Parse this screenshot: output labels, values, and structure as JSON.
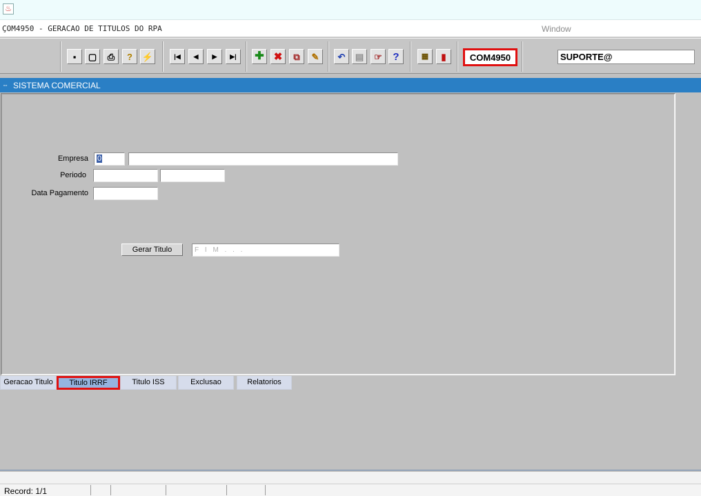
{
  "window": {
    "title": "ÇOM4950 - GERACAO DE TITULOS DO RPA",
    "menu_window": "Window"
  },
  "toolbar": {
    "icons": [
      "save-icon",
      "clear-icon",
      "print-icon",
      "query-enter-icon",
      "query-execute-icon",
      "first-record-icon",
      "previous-record-icon",
      "next-record-icon",
      "last-record-icon",
      "insert-record-icon",
      "delete-record-icon",
      "duplicate-record-icon",
      "edit-icon",
      "undo-icon",
      "list-icon",
      "lov-icon",
      "help-icon",
      "menu-icon",
      "exit-icon"
    ],
    "form_code": "COM4950",
    "user": "SUPORTE@"
  },
  "header": {
    "title": "SISTEMA COMERCIAL"
  },
  "form": {
    "empresa_label": "Empresa",
    "empresa_code": "0",
    "empresa_name": "",
    "periodo_label": "Periodo",
    "periodo_start": "",
    "periodo_end": "",
    "data_pagamento_label": "Data Pagamento",
    "data_pagamento": "",
    "gerar_button": "Gerar Titulo",
    "status_value": "F I M . . ."
  },
  "tabs": [
    {
      "label": "Geracao Titulo"
    },
    {
      "label": "Titulo IRRF",
      "highlighted": true
    },
    {
      "label": "Titulo ISS"
    },
    {
      "label": "Exclusao"
    },
    {
      "label": "Relatorios"
    }
  ],
  "statusbar": {
    "record": "Record: 1/1"
  },
  "colors": {
    "header_blue": "#2a7fc5",
    "highlight_red": "#e01010",
    "selected_tab": "#95b4df"
  }
}
